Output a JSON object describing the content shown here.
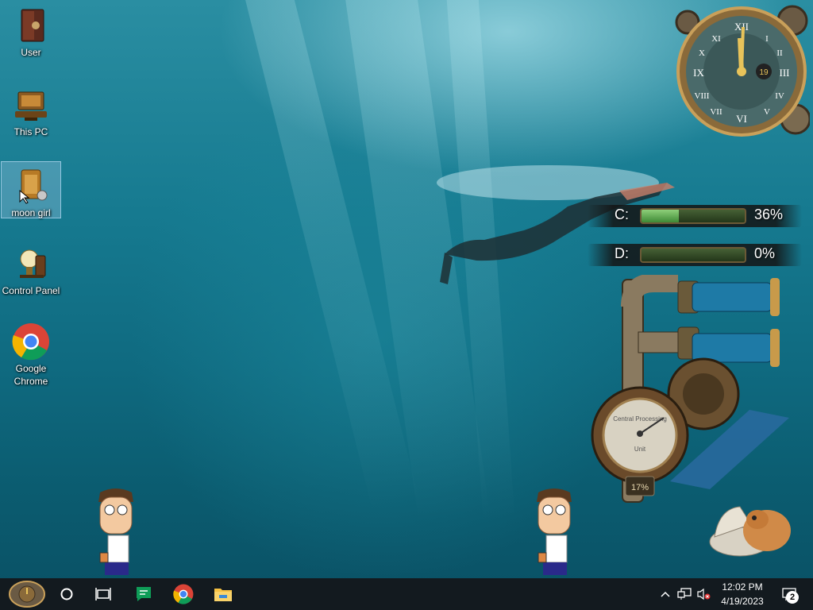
{
  "desktop": {
    "icons": [
      {
        "label": "User"
      },
      {
        "label": "This PC"
      },
      {
        "label": "moon girl"
      },
      {
        "label": "Control Panel"
      },
      {
        "label_line1": "Google",
        "label_line2": "Chrome"
      }
    ]
  },
  "widgets": {
    "clock": {
      "date_day": "19"
    },
    "drives": [
      {
        "letter": "C:",
        "percent_text": "36%",
        "used_fraction": 0.36
      },
      {
        "letter": "D:",
        "percent_text": "0%",
        "used_fraction": 0.0
      }
    ],
    "cpu_meter": {
      "percent_text": "17%",
      "gauge_label_top": "Central Processing",
      "gauge_label_bottom": "Unit"
    }
  },
  "taskbar": {
    "time": "12:02 PM",
    "date": "4/19/2023",
    "notification_count": "2",
    "pinned": [
      "start-icon",
      "search-icon",
      "task-view-icon",
      "google-chat-icon",
      "chrome-icon",
      "file-explorer-icon"
    ]
  },
  "colors": {
    "taskbar_bg": "#131a1f",
    "water": "#167a90",
    "bar_fill": "#5aa84a"
  }
}
